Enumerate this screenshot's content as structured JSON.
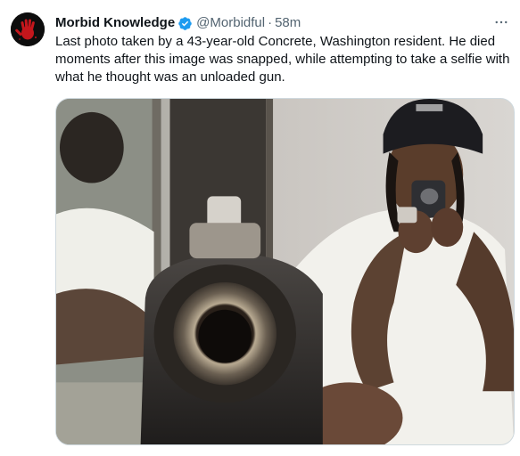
{
  "tweet": {
    "author_name": "Morbid Knowledge",
    "handle": "@Morbidful",
    "separator": "·",
    "time": "58m",
    "text": "Last photo taken by a 43-year-old Concrete, Washington resident. He died moments after this image was snapped, while attempting to take a selfie with what he thought was an unloaded gun.",
    "verified": true,
    "icons": {
      "avatar": "red-handprint-avatar",
      "verified": "verified-badge-icon",
      "more": "more-options-icon"
    },
    "colors": {
      "verified": "#1d9bf0",
      "secondary_text": "#536471",
      "avatar_hand": "#c4161c"
    }
  }
}
